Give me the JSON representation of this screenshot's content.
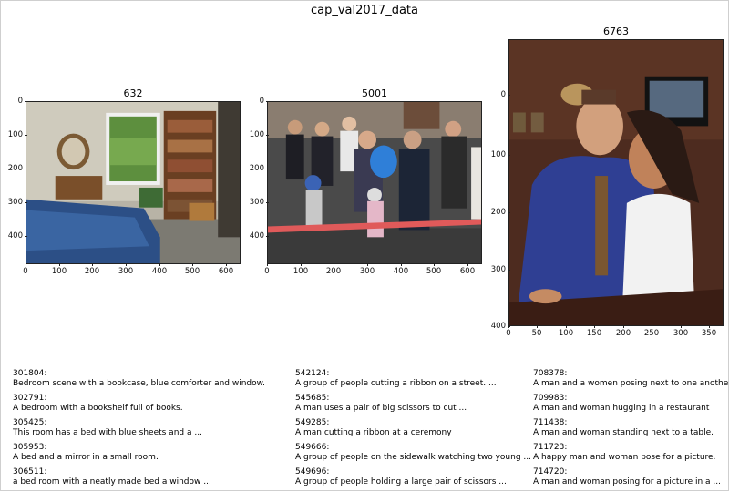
{
  "figure": {
    "title": "cap_val2017_data"
  },
  "panels": [
    {
      "title": "632",
      "yticks": [
        "0",
        "100",
        "200",
        "300",
        "400"
      ],
      "xticks": [
        "0",
        "100",
        "200",
        "300",
        "400",
        "500",
        "600"
      ],
      "captions": [
        {
          "id": "301804:",
          "text": "Bedroom scene with a bookcase, blue comforter and window."
        },
        {
          "id": "302791:",
          "text": "A bedroom with a bookshelf full of books."
        },
        {
          "id": "305425:",
          "text": "This room has a bed with blue sheets and a ..."
        },
        {
          "id": "305953:",
          "text": "A bed and a mirror in a small room."
        },
        {
          "id": "306511:",
          "text": "a bed room with a neatly made bed a window ..."
        }
      ]
    },
    {
      "title": "5001",
      "yticks": [
        "0",
        "100",
        "200",
        "300",
        "400"
      ],
      "xticks": [
        "0",
        "100",
        "200",
        "300",
        "400",
        "500",
        "600"
      ],
      "captions": [
        {
          "id": "542124:",
          "text": "A group of people cutting a ribbon on a street. ..."
        },
        {
          "id": "545685:",
          "text": "A man uses a pair of big scissors to cut ..."
        },
        {
          "id": "549285:",
          "text": "A man cutting a ribbon at a ceremony"
        },
        {
          "id": "549666:",
          "text": "A group of people on the sidewalk watching two young ..."
        },
        {
          "id": "549696:",
          "text": "A group of people holding a large pair of scissors ..."
        }
      ]
    },
    {
      "title": "6763",
      "yticks": [
        "0",
        "100",
        "200",
        "300",
        "400"
      ],
      "xticks": [
        "0",
        "50",
        "100",
        "150",
        "200",
        "250",
        "300",
        "350"
      ],
      "captions": [
        {
          "id": "708378:",
          "text": "A man and a women posing next to one another ..."
        },
        {
          "id": "709983:",
          "text": "A man and woman hugging in a restaurant"
        },
        {
          "id": "711438:",
          "text": "A man and woman standing next to a table."
        },
        {
          "id": "711723:",
          "text": "A happy man and woman pose for a picture."
        },
        {
          "id": "714720:",
          "text": "A man and woman posing for a picture in a ..."
        }
      ]
    }
  ]
}
